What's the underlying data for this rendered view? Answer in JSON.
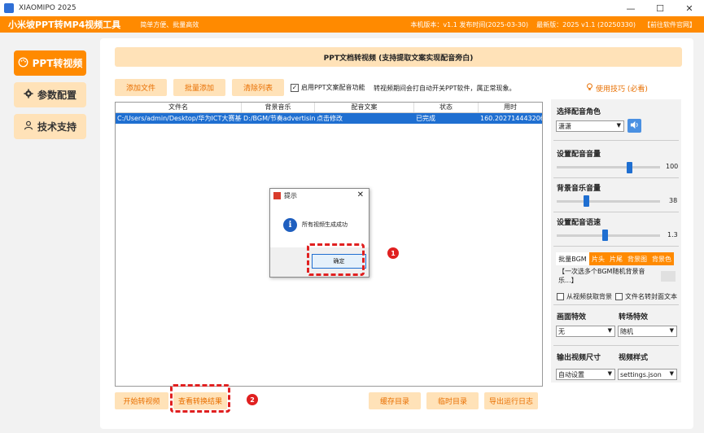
{
  "window": {
    "title": "XIAOMIPO 2025",
    "minimize": "—",
    "maximize": "☐",
    "close": "✕"
  },
  "appbar": {
    "name": "小米坡PPT转MP4视频工具",
    "slogan": "简单方便、批量高效",
    "version": "本机版本：v1.1  发布时间(2025-03-30)",
    "latest": "最新版：2025 v1.1 (20250330)",
    "goto": "【前往软件官网】"
  },
  "sidebar": {
    "items": [
      {
        "icon": "palette-icon",
        "label": "PPT转视频"
      },
      {
        "icon": "gear-icon",
        "label": "参数配置"
      },
      {
        "icon": "user-icon",
        "label": "技术支持"
      }
    ]
  },
  "header": {
    "title": "PPT文档转视频 (支持提取文案实现配音旁白)"
  },
  "toolbar": {
    "add_file": "添加文件",
    "batch_add": "批量添加",
    "clear_list": "清除列表",
    "enable_voice": "启用PPT文案配音功能",
    "note": "转视频期间会打自动开关PPT软件，属正常现象。",
    "tips": "使用技巧 (必看)"
  },
  "table": {
    "columns": [
      "文件名",
      "背景音乐",
      "配音文案",
      "状态",
      "用时"
    ],
    "rows": [
      [
        "C:/Users/admin/Desktop/华为ICT大赛基础",
        "D:/BGM/节奏advertising",
        "点击修改",
        "已完成",
        "160.2027144432068"
      ]
    ]
  },
  "dialog": {
    "title": "提示",
    "icon": "i",
    "message": "所有视频生成成功",
    "ok": "确定"
  },
  "badges": {
    "one": "1",
    "two": "2"
  },
  "bottom": {
    "start": "开始转视频",
    "view_results": "查看转换结果",
    "cache_dir": "缓存目录",
    "temp_dir": "临时目录",
    "export_log": "导出运行日志"
  },
  "settings": {
    "voice_role_label": "选择配音角色",
    "voice_role": "潇潇",
    "voice_volume_label": "设置配音音量",
    "voice_volume": "100",
    "voice_volume_fraction": 1.0,
    "bgm_volume_label": "背景音乐音量",
    "bgm_volume": "38",
    "bgm_volume_fraction": 0.38,
    "speed_label": "设置配音语速",
    "speed": "1.3",
    "speed_fraction": 0.65,
    "bgm_tabs": [
      "批量BGM",
      "片头",
      "片尾",
      "背景图",
      "背景色"
    ],
    "bgm_input": "【一次选多个BGM随机背景音乐...】",
    "from_video_bg": "从视频获取背景",
    "filename_cover": "文件名转封面文本",
    "effect_label": "画面特效",
    "effect": "无",
    "transition_label": "转场特效",
    "transition": "随机",
    "size_label": "输出视频尺寸",
    "size": "自动设置",
    "style_label": "视频样式",
    "style": "settings.json"
  }
}
